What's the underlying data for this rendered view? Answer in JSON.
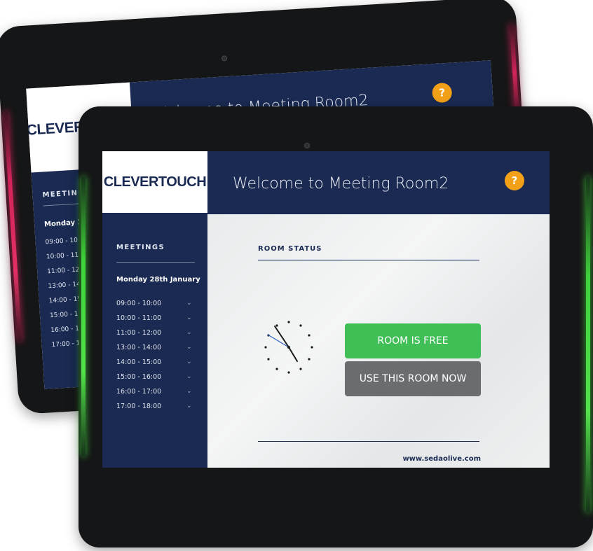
{
  "brand": {
    "logo": "CLEVERTOUCH"
  },
  "header": {
    "welcome": "Welcome to Meeting Room2",
    "help_icon": "?"
  },
  "sidebar": {
    "title": "MEETINGS",
    "day": "Monday 28th January",
    "day_truncated": "Monday 28th",
    "slots": [
      "09:00 - 10:00",
      "10:00 - 11:00",
      "11:00 - 12:00",
      "13:00 - 14:00",
      "14:00 - 15:00",
      "15:00 - 16:00",
      "16:00 - 17:00",
      "17:00 - 18:00"
    ],
    "slots_truncated": [
      "09:00 - 10:00",
      "10:00 - 11:00",
      "11:00 - 12:00",
      "13:00 - 14:00",
      "14:00 - 15:00",
      "15:00 - 16:00",
      "16:00 - 17:00",
      "17:00 - 18:00"
    ]
  },
  "main": {
    "status_title": "ROOM STATUS",
    "status_button": "ROOM IS FREE",
    "use_button": "USE THIS ROOM NOW",
    "url": "www.sedaolive.com"
  },
  "colors": {
    "navy": "#1a2a52",
    "free_green": "#3fbf55",
    "gray_button": "#6a6d6f",
    "help_orange": "#f2a018",
    "led_red": "#d2245a",
    "led_green": "#3fd23a"
  },
  "icons": {
    "help": "question-icon",
    "chevron": "chevron-down-icon",
    "clock": "clock-icon"
  }
}
